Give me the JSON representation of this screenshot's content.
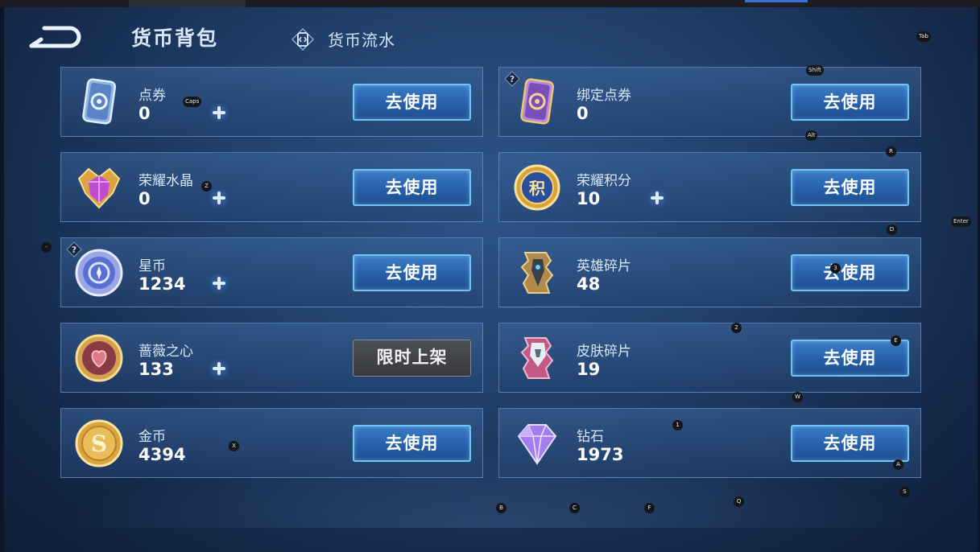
{
  "header": {
    "title": "货币背包",
    "flow_label": "货币流水"
  },
  "cards": [
    {
      "name": "点券",
      "amount": "0",
      "has_plus": true,
      "has_question": false,
      "button": "去使用",
      "button_state": "active",
      "icon": "coupon-card-icon"
    },
    {
      "name": "绑定点券",
      "amount": "0",
      "has_plus": false,
      "has_question": true,
      "button": "去使用",
      "button_state": "active",
      "icon": "bound-coupon-card-icon"
    },
    {
      "name": "荣耀水晶",
      "amount": "0",
      "has_plus": true,
      "has_question": false,
      "button": "去使用",
      "button_state": "active",
      "icon": "glory-crystal-icon"
    },
    {
      "name": "荣耀积分",
      "amount": "10",
      "has_plus": true,
      "has_question": false,
      "button": "去使用",
      "button_state": "active",
      "icon": "glory-points-icon"
    },
    {
      "name": "星币",
      "amount": "1234",
      "has_plus": true,
      "has_question": true,
      "button": "去使用",
      "button_state": "active",
      "icon": "star-coin-icon"
    },
    {
      "name": "英雄碎片",
      "amount": "48",
      "has_plus": false,
      "has_question": false,
      "button": "去使用",
      "button_state": "active",
      "icon": "hero-fragment-icon"
    },
    {
      "name": "蔷薇之心",
      "amount": "133",
      "has_plus": true,
      "has_question": false,
      "button": "限时上架",
      "button_state": "disabled",
      "icon": "rose-heart-icon"
    },
    {
      "name": "皮肤碎片",
      "amount": "19",
      "has_plus": false,
      "has_question": false,
      "button": "去使用",
      "button_state": "active",
      "icon": "skin-fragment-icon"
    },
    {
      "name": "金币",
      "amount": "4394",
      "has_plus": false,
      "has_question": false,
      "button": "去使用",
      "button_state": "active",
      "icon": "gold-coin-icon"
    },
    {
      "name": "钻石",
      "amount": "1973",
      "has_plus": false,
      "has_question": false,
      "button": "去使用",
      "button_state": "active",
      "icon": "diamond-icon"
    }
  ],
  "key_overlays": [
    {
      "label": "Tab"
    },
    {
      "label": "Shift"
    },
    {
      "label": "Alt"
    },
    {
      "label": "Caps"
    },
    {
      "label": "R"
    },
    {
      "label": "Z"
    },
    {
      "label": "Enter"
    },
    {
      "label": "D"
    },
    {
      "label": "-"
    },
    {
      "label": "3"
    },
    {
      "label": "2"
    },
    {
      "label": "E"
    },
    {
      "label": "W"
    },
    {
      "label": "1"
    },
    {
      "label": "X"
    },
    {
      "label": "A"
    },
    {
      "label": "S"
    },
    {
      "label": "Q"
    },
    {
      "label": "B"
    },
    {
      "label": "C"
    },
    {
      "label": "F"
    }
  ],
  "colors": {
    "background": "#21406b",
    "button_blue": "#2760a8",
    "button_border": "#6fc6f2",
    "button_disabled": "#3f4247"
  }
}
